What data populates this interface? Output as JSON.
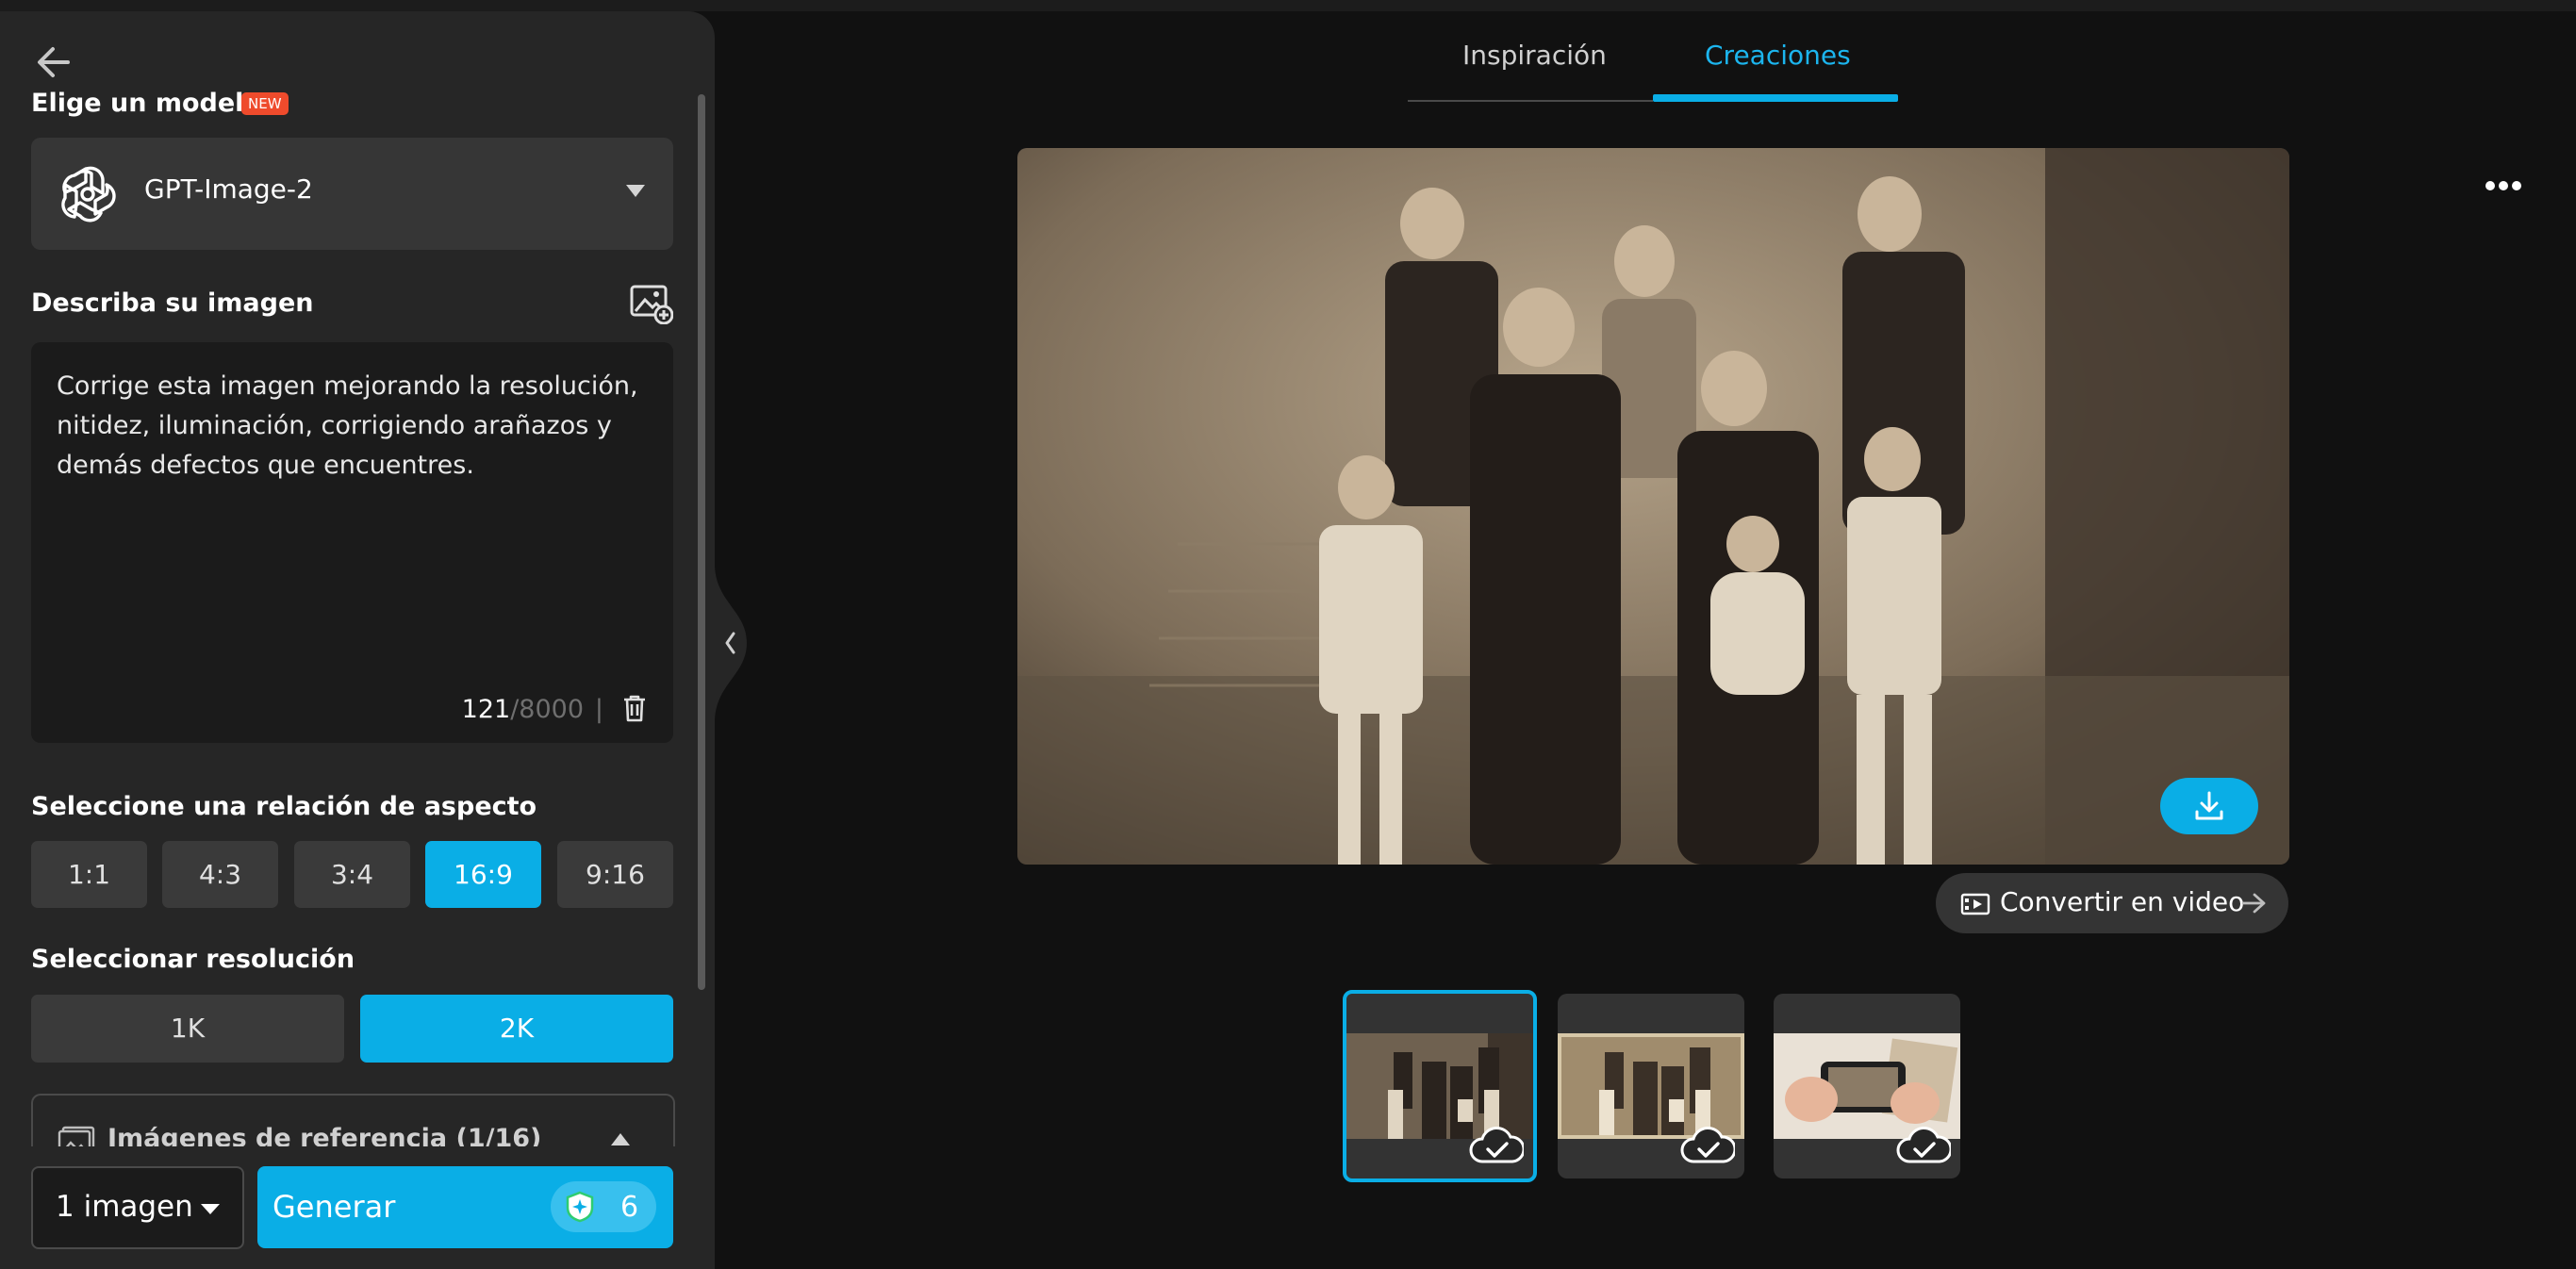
{
  "panel": {
    "model_section_title": "Elige un modelo",
    "new_badge": "NEW",
    "model_name": "GPT-Image-2",
    "describe_title": "Describa su imagen",
    "prompt_text": "Corrige esta imagen mejorando la resolución, nitidez, iluminación, corrigiendo arañazos y demás defectos que encuentres.",
    "char_count": "121",
    "char_max": "/8000",
    "char_separator": "|",
    "aspect_title": "Seleccione una relación de aspecto",
    "aspect_options": [
      "1:1",
      "4:3",
      "3:4",
      "16:9",
      "9:16"
    ],
    "aspect_selected": "16:9",
    "resolution_title": "Seleccionar resolución",
    "resolution_options": [
      "1K",
      "2K"
    ],
    "resolution_selected": "2K",
    "reference_label": "Imágenes de referencia (1/16)",
    "quantity_label": "1 imagen",
    "generate_label": "Generar",
    "credits": "6"
  },
  "main": {
    "tabs": [
      "Inspiración",
      "Creaciones"
    ],
    "active_tab": "Creaciones",
    "convert_label": "Convertir en video",
    "thumbnails": [
      "family-photo-restored",
      "family-photo-original",
      "hands-holding-phone-photo"
    ],
    "selected_thumbnail": 0
  },
  "colors": {
    "accent": "#0aaee6",
    "panel_bg": "#262626",
    "page_bg": "#111111",
    "badge": "#ef4b2c"
  }
}
